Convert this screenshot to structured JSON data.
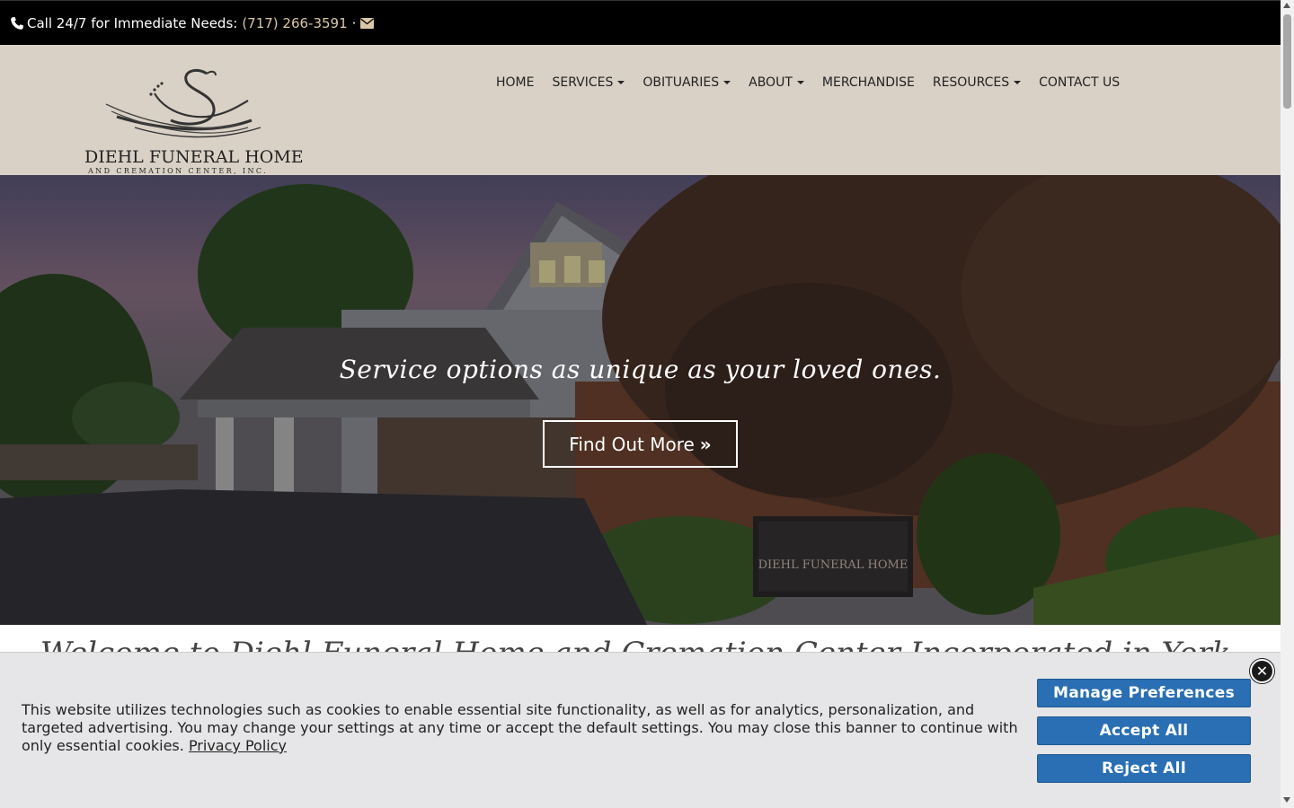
{
  "topbar": {
    "call_text": "Call 24/7 for Immediate Needs:",
    "phone": "(717) 266-3591",
    "separator": "·",
    "phone_icon": "phone-icon",
    "mail_icon": "envelope-icon"
  },
  "logo": {
    "name": "DIEHL FUNERAL HOME",
    "subtitle": "AND CREMATION CENTER, INC.",
    "icon": "swan-icon"
  },
  "nav": {
    "items": [
      {
        "label": "HOME",
        "dropdown": false
      },
      {
        "label": "SERVICES",
        "dropdown": true
      },
      {
        "label": "OBITUARIES",
        "dropdown": true
      },
      {
        "label": "ABOUT",
        "dropdown": true
      },
      {
        "label": "MERCHANDISE",
        "dropdown": false
      },
      {
        "label": "RESOURCES",
        "dropdown": true
      },
      {
        "label": "CONTACT US",
        "dropdown": false
      }
    ]
  },
  "hero": {
    "tagline": "Service options as unique as your loved ones.",
    "button_label": "Find Out More",
    "button_icon": "double-chevron-right-icon",
    "sign_text": "DIEHL FUNERAL HOME"
  },
  "welcome": {
    "heading": "Welcome to Diehl Funeral Home and Cremation Center Incorporated in York, Pennsylvania"
  },
  "cookie": {
    "text": "This website utilizes technologies such as cookies to enable essential site functionality, as well as for analytics, personalization, and targeted advertising. You may change your settings at any time or accept the default settings. You may close this banner to continue with only essential cookies.",
    "policy_link": "Privacy Policy",
    "manage_label": "Manage Preferences",
    "accept_label": "Accept All",
    "reject_label": "Reject All",
    "close_icon": "close-icon",
    "button_color": "#2a6fb3"
  },
  "colors": {
    "topbar_bg": "#000000",
    "header_bg": "#d9d1c6",
    "phone_link": "#d9c7a6"
  }
}
